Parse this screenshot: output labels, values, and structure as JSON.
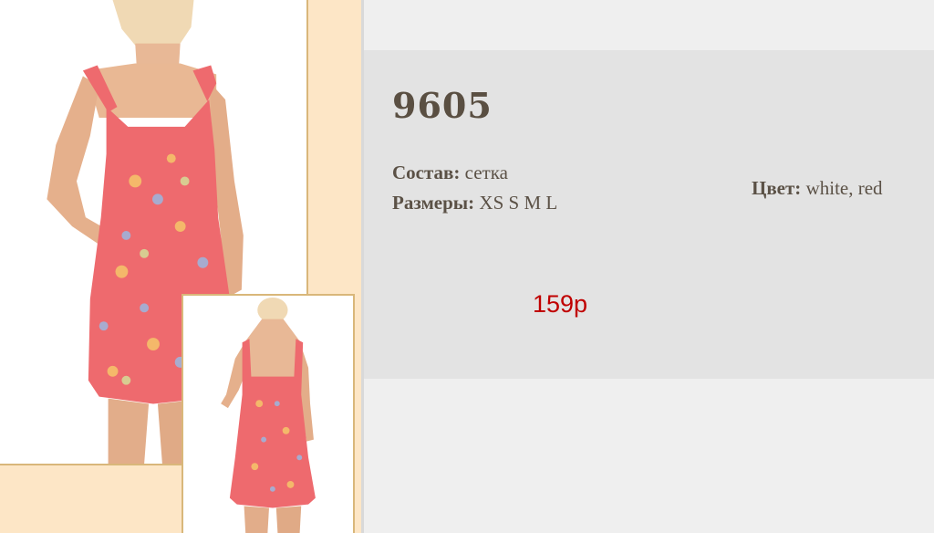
{
  "product": {
    "sku": "9605",
    "composition_label": "Состав:",
    "composition_value": "сетка",
    "sizes_label": "Размеры:",
    "sizes_value": "XS S M L",
    "color_label": "Цвет:",
    "color_value": "white, red",
    "price": "159р"
  },
  "gallery": {
    "main_image": "model-front-photo",
    "thumb_image": "model-back-photo"
  },
  "colors": {
    "price_color": "#c00000",
    "text_color": "#5b5146",
    "gallery_bg": "#fde6c6",
    "frame_border": "#d9b77a",
    "dress_pink": "#ee6a6e"
  }
}
